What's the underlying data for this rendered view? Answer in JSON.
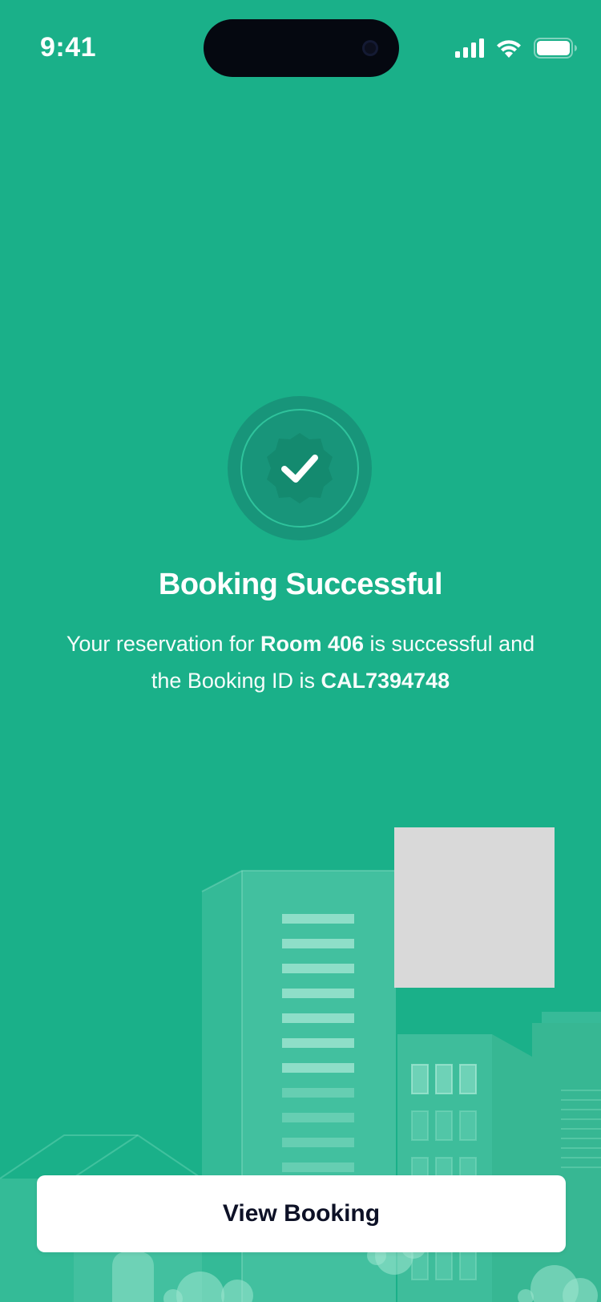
{
  "status_bar": {
    "time": "9:41",
    "icons": [
      "cellular-signal-icon",
      "wifi-icon",
      "battery-icon"
    ]
  },
  "confirmation": {
    "title": "Booking Successful",
    "message_prefix": "Your reservation for ",
    "room": "Room 406",
    "message_middle": " is successful and the  Booking ID is ",
    "booking_id": "CAL7394748",
    "badge_icon": "check-badge-icon"
  },
  "actions": {
    "view_booking_label": "View Booking"
  },
  "colors": {
    "background": "#1AB089",
    "badge_outer": "#18957A",
    "button_text": "#0D1126",
    "placeholder": "#D9D9D9"
  }
}
